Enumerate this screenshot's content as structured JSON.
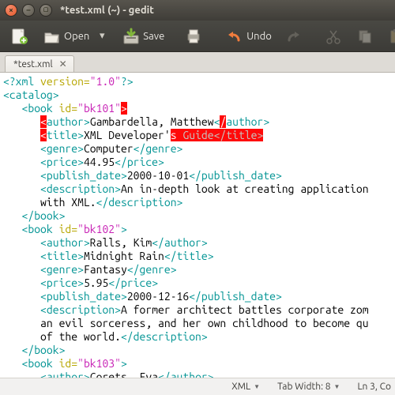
{
  "window": {
    "title": "*test.xml (~) - gedit"
  },
  "toolbar": {
    "new_label": "",
    "open_label": "Open",
    "save_label": "Save",
    "undo_label": "Undo"
  },
  "tab": {
    "label": "*test.xml"
  },
  "code": {
    "l1_a": "<?xml",
    "l1_b": " version=",
    "l1_c": "\"1.0\"",
    "l1_d": "?>",
    "l2_a": "<catalog>",
    "l3_sp": "   ",
    "l3_a": "<book",
    "l3_b": " id=",
    "l3_c": "\"bk101\"",
    "l3_hi1": ">",
    "l3_rest": "",
    "l4_sp": "      ",
    "l4_hi1": "<",
    "l4_a": "author>",
    "l4_txt": "Gambardella, Matthew",
    "l4_b": "<",
    "l4_hi2": "/",
    "l4_c": "author>",
    "l5_sp": "      ",
    "l5_hi1": "<",
    "l5_a": "title>",
    "l5_txt": "XML Developer'",
    "l5_hi2": "s",
    "l5_sel": " Guide</title>",
    "l6_sp": "      ",
    "l6_a": "<genre>",
    "l6_txt": "Computer",
    "l6_b": "</genre>",
    "l7_sp": "      ",
    "l7_a": "<price>",
    "l7_txt": "44.95",
    "l7_b": "</price>",
    "l8_sp": "      ",
    "l8_a": "<publish_date>",
    "l8_txt": "2000-10-01",
    "l8_b": "</publish_date>",
    "l9_sp": "      ",
    "l9_a": "<description>",
    "l9_txt": "An in-depth look at creating application",
    "l10_sp": "      ",
    "l10_txt": "with XML.",
    "l10_b": "</description>",
    "l11_sp": "   ",
    "l11_a": "</book>",
    "l12_sp": "   ",
    "l12_a": "<book",
    "l12_b": " id=",
    "l12_c": "\"bk102\"",
    "l12_d": ">",
    "l13_sp": "      ",
    "l13_a": "<author>",
    "l13_txt": "Ralls, Kim",
    "l13_b": "</author>",
    "l14_sp": "      ",
    "l14_a": "<title>",
    "l14_txt": "Midnight Rain",
    "l14_b": "</title>",
    "l15_sp": "      ",
    "l15_a": "<genre>",
    "l15_txt": "Fantasy",
    "l15_b": "</genre>",
    "l16_sp": "      ",
    "l16_a": "<price>",
    "l16_txt": "5.95",
    "l16_b": "</price>",
    "l17_sp": "      ",
    "l17_a": "<publish_date>",
    "l17_txt": "2000-12-16",
    "l17_b": "</publish_date>",
    "l18_sp": "      ",
    "l18_a": "<description>",
    "l18_txt": "A former architect battles corporate zom",
    "l19_sp": "      ",
    "l19_txt": "an evil sorceress, and her own childhood to become qu",
    "l20_sp": "      ",
    "l20_txt": "of the world.",
    "l20_b": "</description>",
    "l21_sp": "   ",
    "l21_a": "</book>",
    "l22_sp": "   ",
    "l22_a": "<book",
    "l22_b": " id=",
    "l22_c": "\"bk103\"",
    "l22_d": ">",
    "l23_sp": "      ",
    "l23_a": "<author>",
    "l23_txt": "Corets, Eva",
    "l23_b": "</author>"
  },
  "status": {
    "lang": "XML",
    "tabwidth": "Tab Width: 8",
    "pos": "Ln 3, Co"
  }
}
